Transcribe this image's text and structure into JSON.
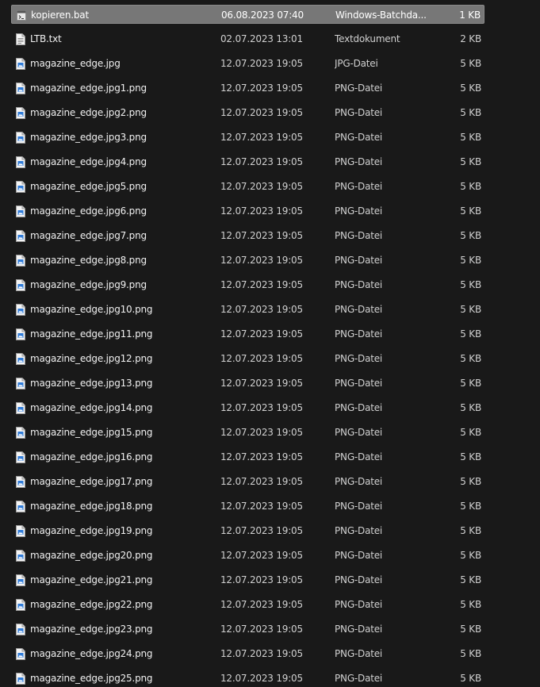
{
  "files": [
    {
      "name": "kopieren.bat",
      "date": "06.08.2023 07:40",
      "type": "Windows-Batchda...",
      "size": "1 KB",
      "icon": "batch-file-icon",
      "selected": true
    },
    {
      "name": "LTB.txt",
      "date": "02.07.2023 13:01",
      "type": "Textdokument",
      "size": "2 KB",
      "icon": "text-file-icon",
      "selected": false
    },
    {
      "name": "magazine_edge.jpg",
      "date": "12.07.2023 19:05",
      "type": "JPG-Datei",
      "size": "5 KB",
      "icon": "image-file-icon",
      "selected": false
    },
    {
      "name": "magazine_edge.jpg1.png",
      "date": "12.07.2023 19:05",
      "type": "PNG-Datei",
      "size": "5 KB",
      "icon": "image-file-icon",
      "selected": false
    },
    {
      "name": "magazine_edge.jpg2.png",
      "date": "12.07.2023 19:05",
      "type": "PNG-Datei",
      "size": "5 KB",
      "icon": "image-file-icon",
      "selected": false
    },
    {
      "name": "magazine_edge.jpg3.png",
      "date": "12.07.2023 19:05",
      "type": "PNG-Datei",
      "size": "5 KB",
      "icon": "image-file-icon",
      "selected": false
    },
    {
      "name": "magazine_edge.jpg4.png",
      "date": "12.07.2023 19:05",
      "type": "PNG-Datei",
      "size": "5 KB",
      "icon": "image-file-icon",
      "selected": false
    },
    {
      "name": "magazine_edge.jpg5.png",
      "date": "12.07.2023 19:05",
      "type": "PNG-Datei",
      "size": "5 KB",
      "icon": "image-file-icon",
      "selected": false
    },
    {
      "name": "magazine_edge.jpg6.png",
      "date": "12.07.2023 19:05",
      "type": "PNG-Datei",
      "size": "5 KB",
      "icon": "image-file-icon",
      "selected": false
    },
    {
      "name": "magazine_edge.jpg7.png",
      "date": "12.07.2023 19:05",
      "type": "PNG-Datei",
      "size": "5 KB",
      "icon": "image-file-icon",
      "selected": false
    },
    {
      "name": "magazine_edge.jpg8.png",
      "date": "12.07.2023 19:05",
      "type": "PNG-Datei",
      "size": "5 KB",
      "icon": "image-file-icon",
      "selected": false
    },
    {
      "name": "magazine_edge.jpg9.png",
      "date": "12.07.2023 19:05",
      "type": "PNG-Datei",
      "size": "5 KB",
      "icon": "image-file-icon",
      "selected": false
    },
    {
      "name": "magazine_edge.jpg10.png",
      "date": "12.07.2023 19:05",
      "type": "PNG-Datei",
      "size": "5 KB",
      "icon": "image-file-icon",
      "selected": false
    },
    {
      "name": "magazine_edge.jpg11.png",
      "date": "12.07.2023 19:05",
      "type": "PNG-Datei",
      "size": "5 KB",
      "icon": "image-file-icon",
      "selected": false
    },
    {
      "name": "magazine_edge.jpg12.png",
      "date": "12.07.2023 19:05",
      "type": "PNG-Datei",
      "size": "5 KB",
      "icon": "image-file-icon",
      "selected": false
    },
    {
      "name": "magazine_edge.jpg13.png",
      "date": "12.07.2023 19:05",
      "type": "PNG-Datei",
      "size": "5 KB",
      "icon": "image-file-icon",
      "selected": false
    },
    {
      "name": "magazine_edge.jpg14.png",
      "date": "12.07.2023 19:05",
      "type": "PNG-Datei",
      "size": "5 KB",
      "icon": "image-file-icon",
      "selected": false
    },
    {
      "name": "magazine_edge.jpg15.png",
      "date": "12.07.2023 19:05",
      "type": "PNG-Datei",
      "size": "5 KB",
      "icon": "image-file-icon",
      "selected": false
    },
    {
      "name": "magazine_edge.jpg16.png",
      "date": "12.07.2023 19:05",
      "type": "PNG-Datei",
      "size": "5 KB",
      "icon": "image-file-icon",
      "selected": false
    },
    {
      "name": "magazine_edge.jpg17.png",
      "date": "12.07.2023 19:05",
      "type": "PNG-Datei",
      "size": "5 KB",
      "icon": "image-file-icon",
      "selected": false
    },
    {
      "name": "magazine_edge.jpg18.png",
      "date": "12.07.2023 19:05",
      "type": "PNG-Datei",
      "size": "5 KB",
      "icon": "image-file-icon",
      "selected": false
    },
    {
      "name": "magazine_edge.jpg19.png",
      "date": "12.07.2023 19:05",
      "type": "PNG-Datei",
      "size": "5 KB",
      "icon": "image-file-icon",
      "selected": false
    },
    {
      "name": "magazine_edge.jpg20.png",
      "date": "12.07.2023 19:05",
      "type": "PNG-Datei",
      "size": "5 KB",
      "icon": "image-file-icon",
      "selected": false
    },
    {
      "name": "magazine_edge.jpg21.png",
      "date": "12.07.2023 19:05",
      "type": "PNG-Datei",
      "size": "5 KB",
      "icon": "image-file-icon",
      "selected": false
    },
    {
      "name": "magazine_edge.jpg22.png",
      "date": "12.07.2023 19:05",
      "type": "PNG-Datei",
      "size": "5 KB",
      "icon": "image-file-icon",
      "selected": false
    },
    {
      "name": "magazine_edge.jpg23.png",
      "date": "12.07.2023 19:05",
      "type": "PNG-Datei",
      "size": "5 KB",
      "icon": "image-file-icon",
      "selected": false
    },
    {
      "name": "magazine_edge.jpg24.png",
      "date": "12.07.2023 19:05",
      "type": "PNG-Datei",
      "size": "5 KB",
      "icon": "image-file-icon",
      "selected": false
    },
    {
      "name": "magazine_edge.jpg25.png",
      "date": "12.07.2023 19:05",
      "type": "PNG-Datei",
      "size": "5 KB",
      "icon": "image-file-icon",
      "selected": false
    }
  ],
  "colors": {
    "background": "#191919",
    "selection": "#777777",
    "image_icon_accent": "#2f7bd8",
    "batch_icon_accent": "#555555"
  }
}
